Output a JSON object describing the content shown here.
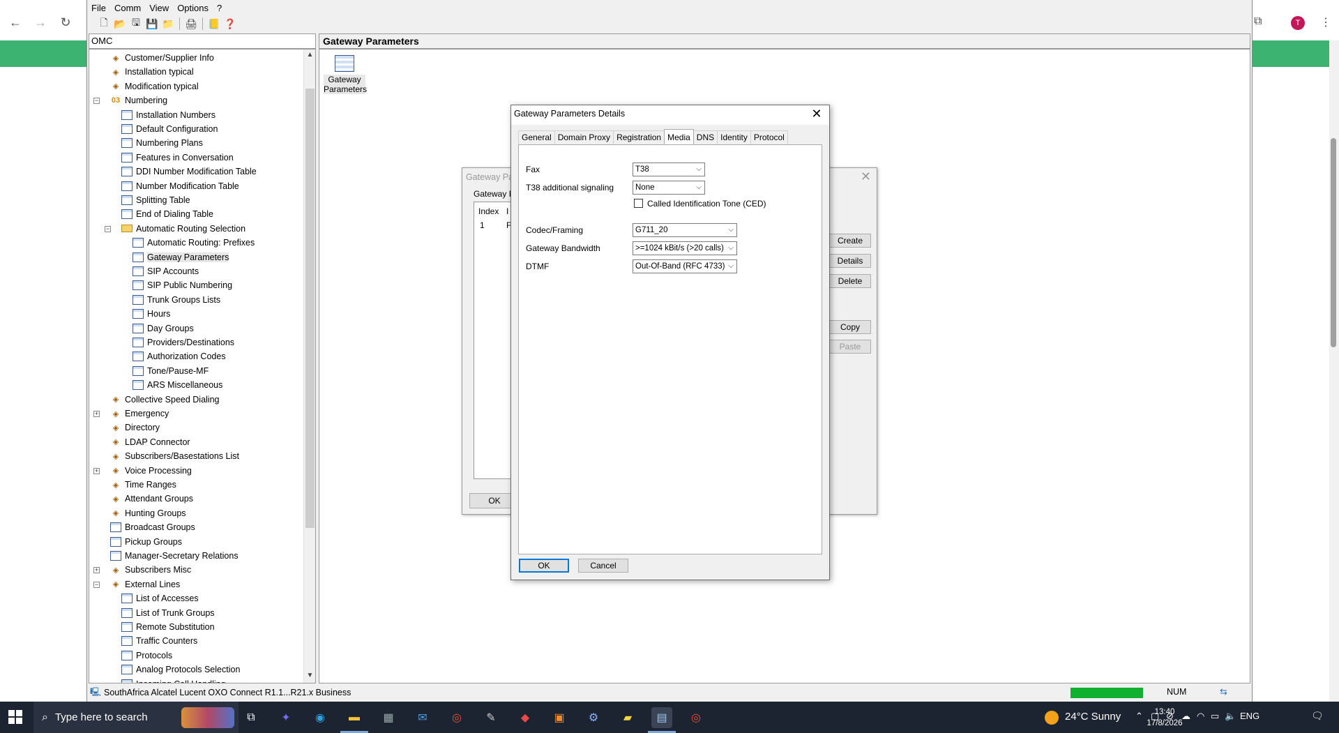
{
  "app": {
    "menu": [
      "File",
      "Comm",
      "View",
      "Options",
      "?"
    ],
    "toolbar_icons": [
      "new-icon",
      "open-icon",
      "save-as-icon",
      "save-icon",
      "export-icon",
      "print-icon",
      "book-icon",
      "help-icon"
    ],
    "left_title": "OMC",
    "right_title": "Gateway Parameters",
    "desktop_icon_label": "Gateway Parameters",
    "statusbar": {
      "text": "SouthAfrica Alcatel Lucent OXO Connect R1.1...R21.x Business",
      "num": "NUM"
    }
  },
  "tree": {
    "items": [
      {
        "label": "Customer/Supplier Info",
        "level": 1,
        "icon": "pic"
      },
      {
        "label": "Installation typical",
        "level": 1,
        "icon": "pic"
      },
      {
        "label": "Modification typical",
        "level": 1,
        "icon": "pic"
      },
      {
        "label": "Numbering",
        "level": 1,
        "icon": "num",
        "expander": "−"
      },
      {
        "label": "Installation Numbers",
        "level": 2,
        "icon": "grid"
      },
      {
        "label": "Default Configuration",
        "level": 2,
        "icon": "grid"
      },
      {
        "label": "Numbering Plans",
        "level": 2,
        "icon": "grid"
      },
      {
        "label": "Features in Conversation",
        "level": 2,
        "icon": "grid"
      },
      {
        "label": "DDI Number Modification Table",
        "level": 2,
        "icon": "grid"
      },
      {
        "label": "Number Modification Table",
        "level": 2,
        "icon": "grid"
      },
      {
        "label": "Splitting Table",
        "level": 2,
        "icon": "grid"
      },
      {
        "label": "End of Dialing Table",
        "level": 2,
        "icon": "grid"
      },
      {
        "label": "Automatic Routing Selection",
        "level": 2,
        "icon": "folder",
        "expander": "−"
      },
      {
        "label": "Automatic Routing: Prefixes",
        "level": 3,
        "icon": "grid"
      },
      {
        "label": "Gateway Parameters",
        "level": 3,
        "icon": "grid",
        "selected": true
      },
      {
        "label": "SIP Accounts",
        "level": 3,
        "icon": "grid"
      },
      {
        "label": "SIP Public Numbering",
        "level": 3,
        "icon": "grid"
      },
      {
        "label": "Trunk Groups Lists",
        "level": 3,
        "icon": "grid"
      },
      {
        "label": "Hours",
        "level": 3,
        "icon": "grid"
      },
      {
        "label": "Day Groups",
        "level": 3,
        "icon": "grid"
      },
      {
        "label": "Providers/Destinations",
        "level": 3,
        "icon": "grid"
      },
      {
        "label": "Authorization Codes",
        "level": 3,
        "icon": "grid"
      },
      {
        "label": "Tone/Pause-MF",
        "level": 3,
        "icon": "grid"
      },
      {
        "label": "ARS Miscellaneous",
        "level": 3,
        "icon": "grid"
      },
      {
        "label": "Collective Speed Dialing",
        "level": 1,
        "icon": "pic"
      },
      {
        "label": "Emergency",
        "level": 1,
        "icon": "pic",
        "expander": "+"
      },
      {
        "label": "Directory",
        "level": 1,
        "icon": "pic"
      },
      {
        "label": "LDAP Connector",
        "level": 1,
        "icon": "pic"
      },
      {
        "label": "Subscribers/Basestations List",
        "level": 1,
        "icon": "pic"
      },
      {
        "label": "Voice Processing",
        "level": 1,
        "icon": "pic",
        "expander": "+"
      },
      {
        "label": "Time Ranges",
        "level": 1,
        "icon": "pic"
      },
      {
        "label": "Attendant Groups",
        "level": 1,
        "icon": "pic"
      },
      {
        "label": "Hunting Groups",
        "level": 1,
        "icon": "pic"
      },
      {
        "label": "Broadcast Groups",
        "level": 1,
        "icon": "grid"
      },
      {
        "label": "Pickup Groups",
        "level": 1,
        "icon": "grid"
      },
      {
        "label": "Manager-Secretary Relations",
        "level": 1,
        "icon": "grid"
      },
      {
        "label": "Subscribers Misc",
        "level": 1,
        "icon": "pic",
        "expander": "+"
      },
      {
        "label": "External Lines",
        "level": 1,
        "icon": "pic",
        "expander": "−"
      },
      {
        "label": "List of Accesses",
        "level": 2,
        "icon": "grid"
      },
      {
        "label": "List of Trunk Groups",
        "level": 2,
        "icon": "grid"
      },
      {
        "label": "Remote Substitution",
        "level": 2,
        "icon": "grid"
      },
      {
        "label": "Traffic Counters",
        "level": 2,
        "icon": "grid"
      },
      {
        "label": "Protocols",
        "level": 2,
        "icon": "grid"
      },
      {
        "label": "Analog Protocols Selection",
        "level": 2,
        "icon": "grid"
      },
      {
        "label": "Incoming Call Handling",
        "level": 2,
        "icon": "grid"
      }
    ]
  },
  "bg_dialog": {
    "title": "Gateway Par",
    "group": "Gateway F",
    "col_index": "Index",
    "col_other": "I",
    "row_index": "1",
    "row_other": "F",
    "buttons": [
      "Create",
      "Details",
      "Delete",
      "Copy",
      "Paste"
    ],
    "ok": "OK"
  },
  "dialog": {
    "title": "Gateway Parameters Details",
    "tabs": [
      "General",
      "Domain Proxy",
      "Registration",
      "Media",
      "DNS",
      "Identity",
      "Protocol"
    ],
    "active_tab": "Media",
    "fields": {
      "fax_label": "Fax",
      "fax_value": "T38",
      "t38_label": "T38 additional signaling",
      "t38_value": "None",
      "ced_label": "Called Identification Tone (CED)",
      "ced_checked": false,
      "codec_label": "Codec/Framing",
      "codec_value": "G711_20",
      "bandwidth_label": "Gateway Bandwidth",
      "bandwidth_value": ">=1024 kBit/s (>20 calls)",
      "dtmf_label": "DTMF",
      "dtmf_value": "Out-Of-Band (RFC 4733)"
    },
    "ok": "OK",
    "cancel": "Cancel"
  },
  "taskbar": {
    "search_placeholder": "Type here to search",
    "weather": "24°C  Sunny",
    "language": "ENG",
    "time": "13:40",
    "date": "17/8/2026"
  },
  "browser": {
    "avatar_letter": "T"
  }
}
